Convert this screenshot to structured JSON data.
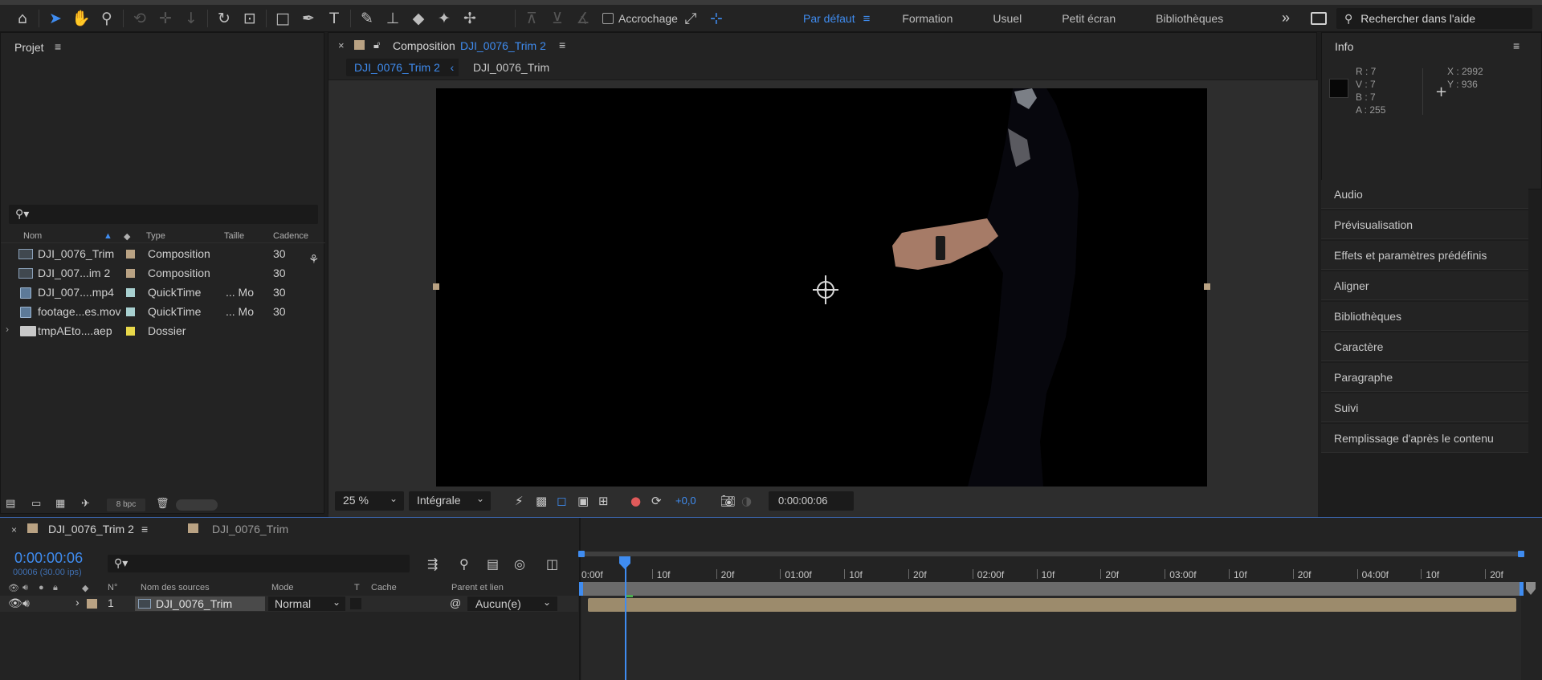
{
  "toolbar": {
    "snap_label": "Accrochage",
    "workspaces": [
      "Par défaut",
      "Formation",
      "Usuel",
      "Petit écran",
      "Bibliothèques"
    ],
    "active_workspace": "Par défaut",
    "more_icon": "»",
    "help_placeholder": "Rechercher dans l'aide"
  },
  "project": {
    "title": "Projet",
    "columns": {
      "name": "Nom",
      "type": "Type",
      "size": "Taille",
      "rate": "Cadence"
    },
    "items": [
      {
        "name": "DJI_0076_Trim",
        "type": "Composition",
        "size": "",
        "rate": "30",
        "icon": "composition-icon",
        "label_color": "#b9a283"
      },
      {
        "name": "DJI_007...im 2",
        "type": "Composition",
        "size": "",
        "rate": "30",
        "icon": "composition-icon",
        "label_color": "#b9a283"
      },
      {
        "name": "DJI_007....mp4",
        "type": "QuickTime",
        "size": "... Mo",
        "rate": "30",
        "icon": "footage-icon",
        "label_color": "#a8d0d0"
      },
      {
        "name": "footage...es.mov",
        "type": "QuickTime",
        "size": "... Mo",
        "rate": "30",
        "icon": "footage-icon",
        "label_color": "#a8d0d0"
      },
      {
        "name": "tmpAEto....aep",
        "type": "Dossier",
        "size": "",
        "rate": "",
        "icon": "folder-icon",
        "label_color": "#e8d84a"
      }
    ],
    "bpc": "8 bpc"
  },
  "composition": {
    "word": "Composition",
    "name": "DJI_0076_Trim 2",
    "breadcrumbs": [
      "DJI_0076_Trim 2",
      "DJI_0076_Trim"
    ],
    "zoom": "25 %",
    "resolution": "Intégrale",
    "exposure": "+0,0",
    "timecode": "0:00:00:06"
  },
  "info": {
    "title": "Info",
    "r": "R : 7",
    "v": "V : 7",
    "b": "B : 7",
    "a": "A :  255",
    "x": "X : 2992",
    "y": "Y : 936"
  },
  "right_panels": [
    "Audio",
    "Prévisualisation",
    "Effets et paramètres prédéfinis",
    "Aligner",
    "Bibliothèques",
    "Caractère",
    "Paragraphe",
    "Suivi",
    "Remplissage d'après le contenu"
  ],
  "timeline": {
    "tabs": [
      "DJI_0076_Trim 2",
      "DJI_0076_Trim"
    ],
    "current_time": "0:00:00:06",
    "frames_info": "00006 (30.00 ips)",
    "columns": {
      "num": "N°",
      "source": "Nom des sources",
      "mode": "Mode",
      "t": "T",
      "matte": "Cache",
      "parent": "Parent et lien"
    },
    "layer": {
      "index": "1",
      "name": "DJI_0076_Trim",
      "mode": "Normal",
      "parent": "Aucun(e)"
    },
    "ruler_ticks": [
      "0:00f",
      "10f",
      "20f",
      "01:00f",
      "10f",
      "20f",
      "02:00f",
      "10f",
      "20f",
      "03:00f",
      "10f",
      "20f",
      "04:00f",
      "10f",
      "20f"
    ]
  }
}
